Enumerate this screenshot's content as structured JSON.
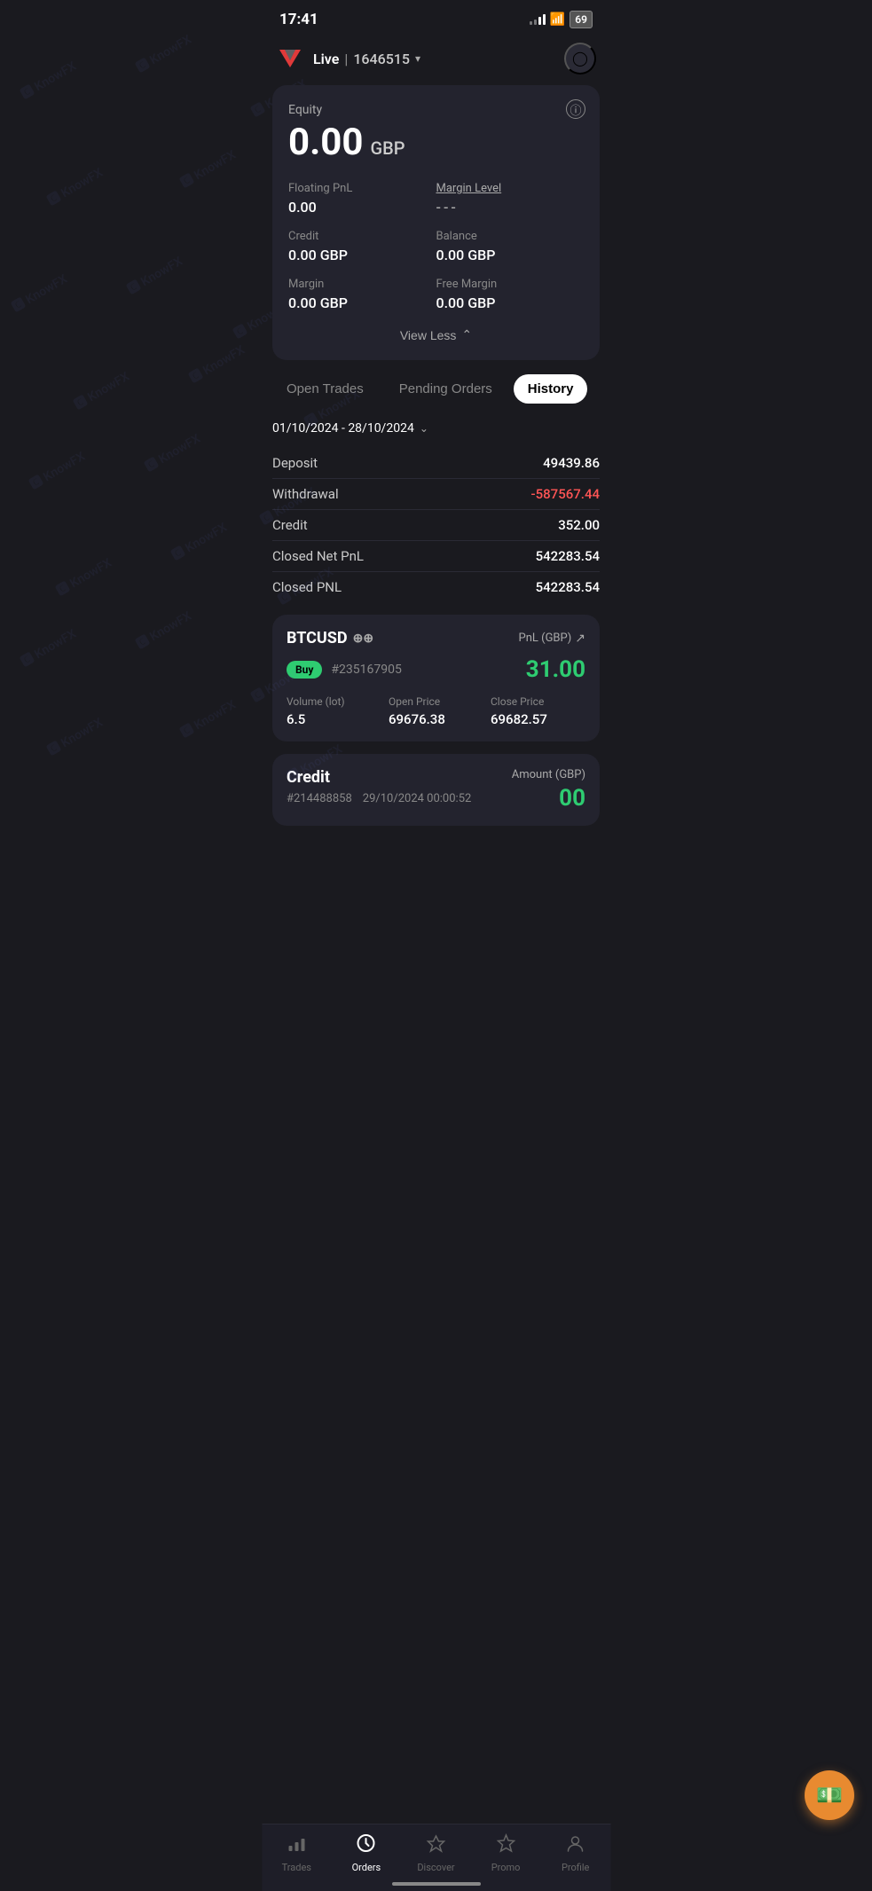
{
  "status": {
    "time": "17:41",
    "battery": "69"
  },
  "header": {
    "mode": "Live",
    "separator": "|",
    "account_number": "1646515",
    "chevron": "▾"
  },
  "account_card": {
    "equity_label": "Equity",
    "equity_value": "0.00",
    "equity_currency": "GBP",
    "floating_pnl_label": "Floating PnL",
    "floating_pnl_value": "0.00",
    "margin_level_label": "Margin Level",
    "margin_level_value": "---",
    "credit_label": "Credit",
    "credit_value": "0.00 GBP",
    "balance_label": "Balance",
    "balance_value": "0.00 GBP",
    "margin_label": "Margin",
    "margin_value": "0.00 GBP",
    "free_margin_label": "Free Margin",
    "free_margin_value": "0.00 GBP",
    "view_less": "View Less"
  },
  "tabs": {
    "open_trades": "Open Trades",
    "pending_orders": "Pending Orders",
    "history": "History"
  },
  "date_range": {
    "label": "01/10/2024 - 28/10/2024"
  },
  "history_stats": [
    {
      "label": "Deposit",
      "value": "49439.86",
      "negative": false
    },
    {
      "label": "Withdrawal",
      "value": "-587567.44",
      "negative": true
    },
    {
      "label": "Credit",
      "value": "352.00",
      "negative": false
    },
    {
      "label": "Closed Net PnL",
      "value": "542283.54",
      "negative": false
    },
    {
      "label": "Closed PNL",
      "value": "542283.54",
      "negative": false
    }
  ],
  "trade_card": {
    "symbol": "BTCUSD",
    "symbol_icon": "⌀⌀",
    "pnl_label": "PnL (GBP)",
    "direction": "Buy",
    "order_number": "#235167905",
    "pnl_value": "31.00",
    "volume_label": "Volume (lot)",
    "volume_value": "6.5",
    "open_price_label": "Open Price",
    "open_price_value": "69676.38",
    "close_price_label": "Close Price",
    "close_price_value": "69682.57"
  },
  "credit_card": {
    "title": "Credit",
    "amount_label": "Amount (GBP)",
    "order_id": "#214488858",
    "date": "29/10/2024 00:00:52",
    "amount_value": "00"
  },
  "bottom_nav": [
    {
      "key": "trades",
      "label": "Trades",
      "icon": "📊",
      "active": false
    },
    {
      "key": "orders",
      "label": "Orders",
      "icon": "⚡",
      "active": true
    },
    {
      "key": "discover",
      "label": "Discover",
      "icon": "◈",
      "active": false
    },
    {
      "key": "promo",
      "label": "Promo",
      "icon": "⚡",
      "active": false
    },
    {
      "key": "profile",
      "label": "Profile",
      "icon": "👤",
      "active": false
    }
  ]
}
